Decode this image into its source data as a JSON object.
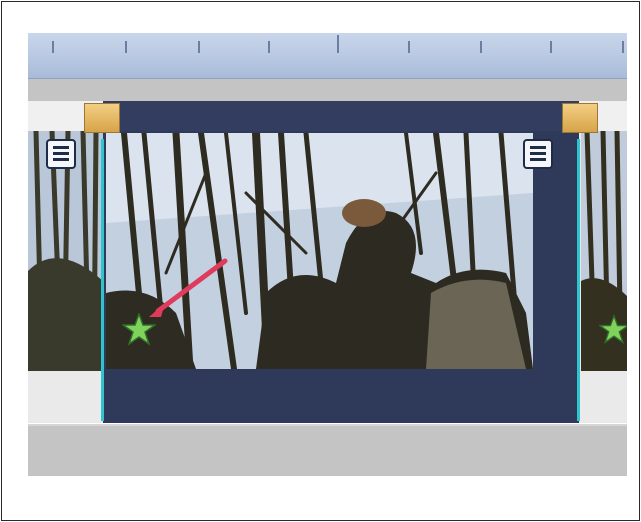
{
  "timeline": {
    "colors": {
      "ruler": "#b8c8e2",
      "selected_clip": "#2f3a5b",
      "handle": "#e8b866",
      "divider": "#2fc4ce",
      "marker_arrow": "#e03a5c",
      "marker_star": "#7fd35a"
    },
    "icons": [
      "trim-handle-icon",
      "clip-menu-icon",
      "star-marker-icon",
      "arrow-annotation-icon"
    ]
  }
}
